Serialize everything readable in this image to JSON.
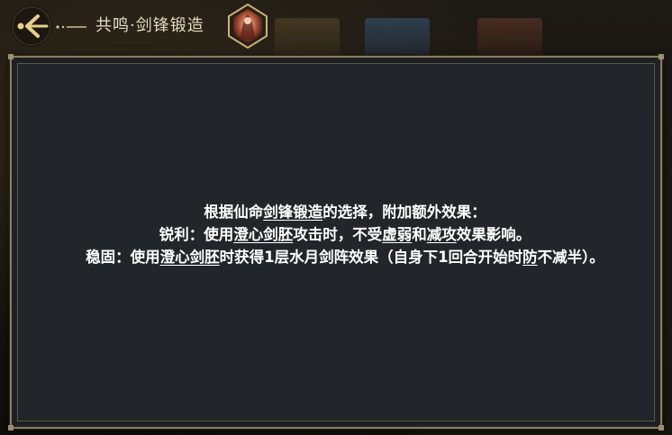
{
  "header": {
    "title": "共鸣·剑锋锻造",
    "back_icon": "back-arrow-icon",
    "portrait_icon": "character-portrait-icon"
  },
  "colors": {
    "title_text": "#e8dcc0",
    "body_text": "#ffffff",
    "frame_gold": "#8c7c60",
    "panel_bg": "#22262a",
    "accent_gold": "#e8cf8a"
  },
  "description": {
    "line1": {
      "t1": "根据仙命",
      "kw1": "剑锋锻造",
      "t2": "的选择，附加额外效果："
    },
    "line2": {
      "t1": "锐利：使用",
      "kw1": "澄心剑胚",
      "t2": "攻击时，不受",
      "kw2": "虚弱",
      "t3": "和",
      "kw3": "减攻",
      "t4": "效果影响。"
    },
    "line3": {
      "t1": "稳固：使用",
      "kw1": "澄心剑胚",
      "t2": "时获得1层水月剑阵效果（自身下1回合开始时",
      "kw2": "防",
      "t3": "不减半）。"
    }
  }
}
